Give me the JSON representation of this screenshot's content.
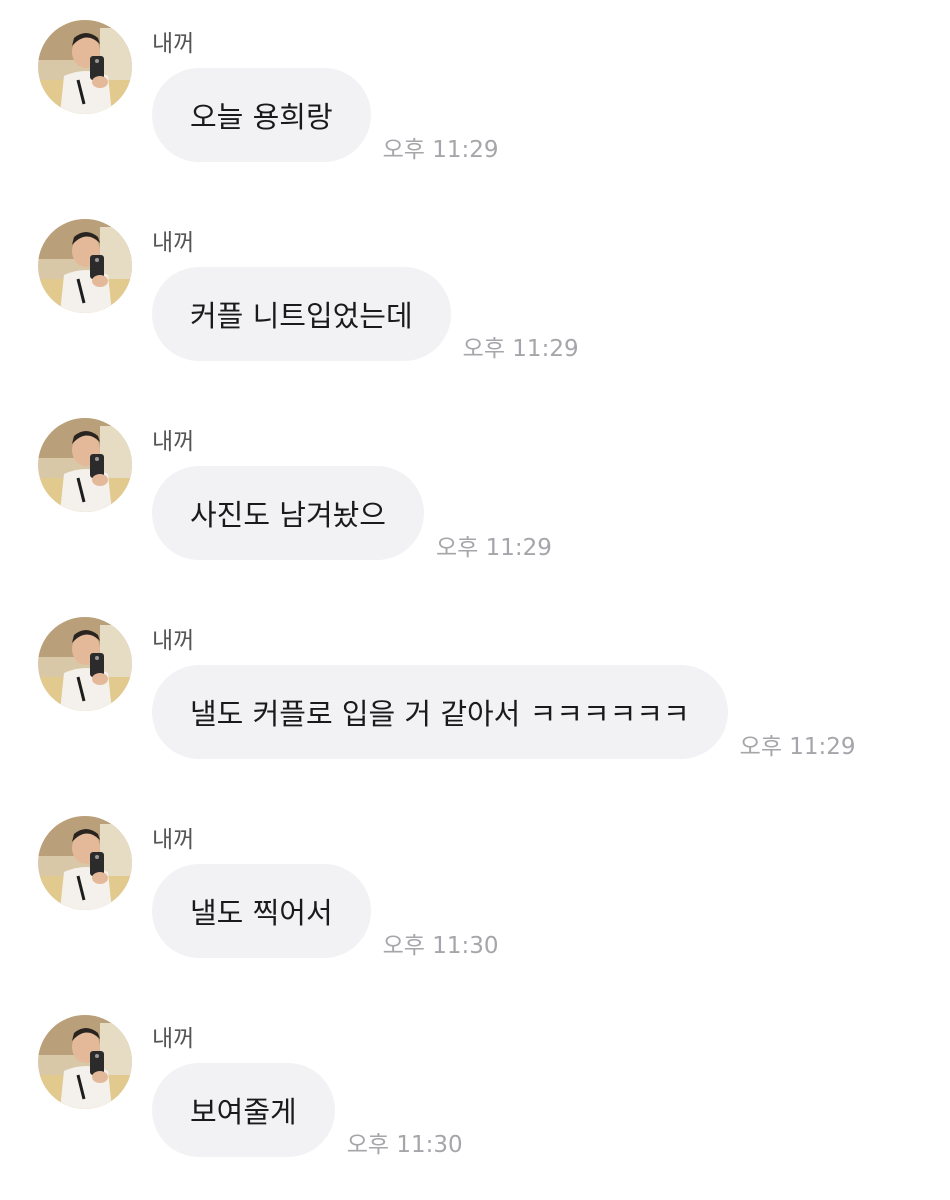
{
  "sender_name": "내꺼",
  "avatar_icon": "profile-photo-avatar",
  "colors": {
    "bubble_bg": "#f2f2f5",
    "text": "#1a1a1a",
    "time": "#a5a5aa",
    "sender": "#555555"
  },
  "messages": [
    {
      "text": "오늘 용희랑",
      "time": "오후 11:29"
    },
    {
      "text": "커플 니트입었는데",
      "time": "오후 11:29"
    },
    {
      "text": "사진도 남겨놨으",
      "time": "오후 11:29"
    },
    {
      "text": "낼도 커플로 입을 거 같아서 ㅋㅋㅋㅋㅋㅋ",
      "time": "오후 11:29"
    },
    {
      "text": "낼도 찍어서",
      "time": "오후 11:30"
    },
    {
      "text": "보여줄게",
      "time": "오후 11:30"
    }
  ]
}
